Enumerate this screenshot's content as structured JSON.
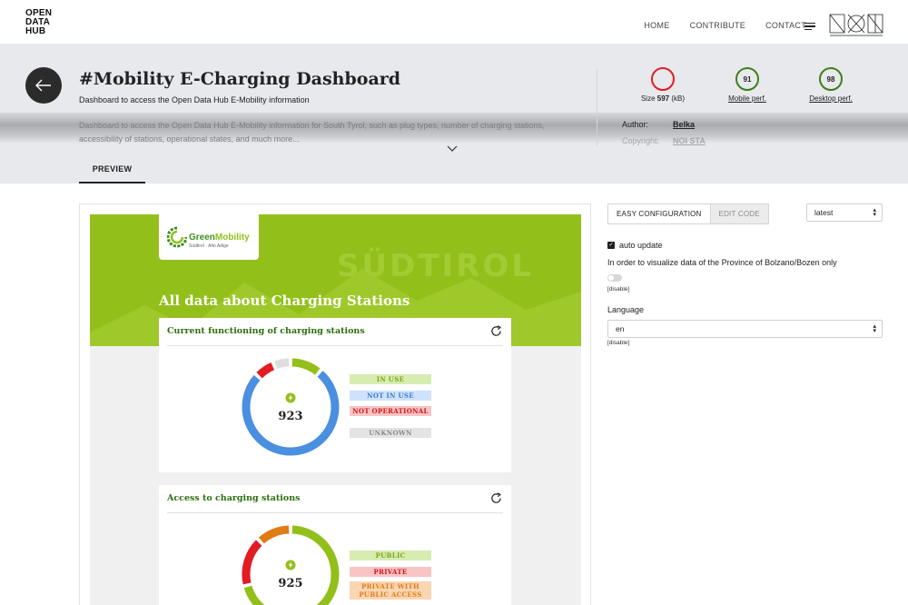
{
  "brand": {
    "logo_lines": [
      "OPEN",
      "DATA",
      "HUB"
    ]
  },
  "nav": {
    "links": [
      "HOME",
      "CONTRIBUTE",
      "CONTACT"
    ]
  },
  "header": {
    "title": "#Mobility E-Charging Dashboard",
    "subtitle": "Dashboard to access the Open Data Hub E-Mobility information",
    "description": "Dashboard to access the Open Data Hub E-Mobility information for South Tyrol, such as plug types, number of charging stations, accessibility of stations, operational states, and much more..."
  },
  "metrics": {
    "size": {
      "label_prefix": "Size",
      "value": "597",
      "unit": "(kB)"
    },
    "mobile": {
      "score": "91",
      "label": "Mobile perf."
    },
    "desktop": {
      "score": "98",
      "label": "Desktop perf."
    }
  },
  "meta": {
    "author_key": "Author:",
    "author_value": "Belka",
    "copyright_key": "Copyright:",
    "copyright_value": "NOI STA"
  },
  "tabs": {
    "preview": "PREVIEW"
  },
  "preview": {
    "logo_name_a": "Green",
    "logo_name_b": "Mobility",
    "logo_sub": "Südtirol · Alto Adige",
    "watermark": "SÜDTIROL",
    "band_title": "All data about Charging Stations",
    "charts": [
      {
        "title": "Current functioning of charging stations",
        "total": "923",
        "legend": [
          "IN USE",
          "NOT IN USE",
          "NOT OPERATIONAL",
          "UNKNOWN"
        ]
      },
      {
        "title": "Access to charging stations",
        "total": "925",
        "legend": [
          "PUBLIC",
          "PRIVATE",
          "PRIVATE WITH PUBLIC ACCESS"
        ]
      }
    ]
  },
  "config": {
    "tab_easy": "EASY CONFIGURATION",
    "tab_code": "EDIT CODE",
    "version": "latest",
    "auto_update": "auto update",
    "province_text": "In order to visualize data of the Province of Bolzano/Bozen only",
    "disable_note": "[disable]",
    "language_label": "Language",
    "language_value": "en"
  },
  "colors": {
    "green": "#93bf1b",
    "dark_green": "#2d6e0e",
    "in_use": "#93bf1b",
    "not_in_use": "#4a8fe0",
    "not_operational": "#e31b23",
    "unknown": "#dddddd",
    "private_public": "#e07b16"
  },
  "chart_data": [
    {
      "type": "pie",
      "title": "Current functioning of charging stations",
      "categories": [
        "IN USE",
        "NOT IN USE",
        "NOT OPERATIONAL",
        "UNKNOWN"
      ],
      "values": [
        0.11,
        0.76,
        0.07,
        0.06
      ],
      "total": 923
    },
    {
      "type": "pie",
      "title": "Access to charging stations",
      "categories": [
        "PUBLIC",
        "PRIVATE",
        "PRIVATE WITH PUBLIC ACCESS"
      ],
      "values": [
        0.71,
        0.17,
        0.12
      ],
      "total": 925
    }
  ]
}
